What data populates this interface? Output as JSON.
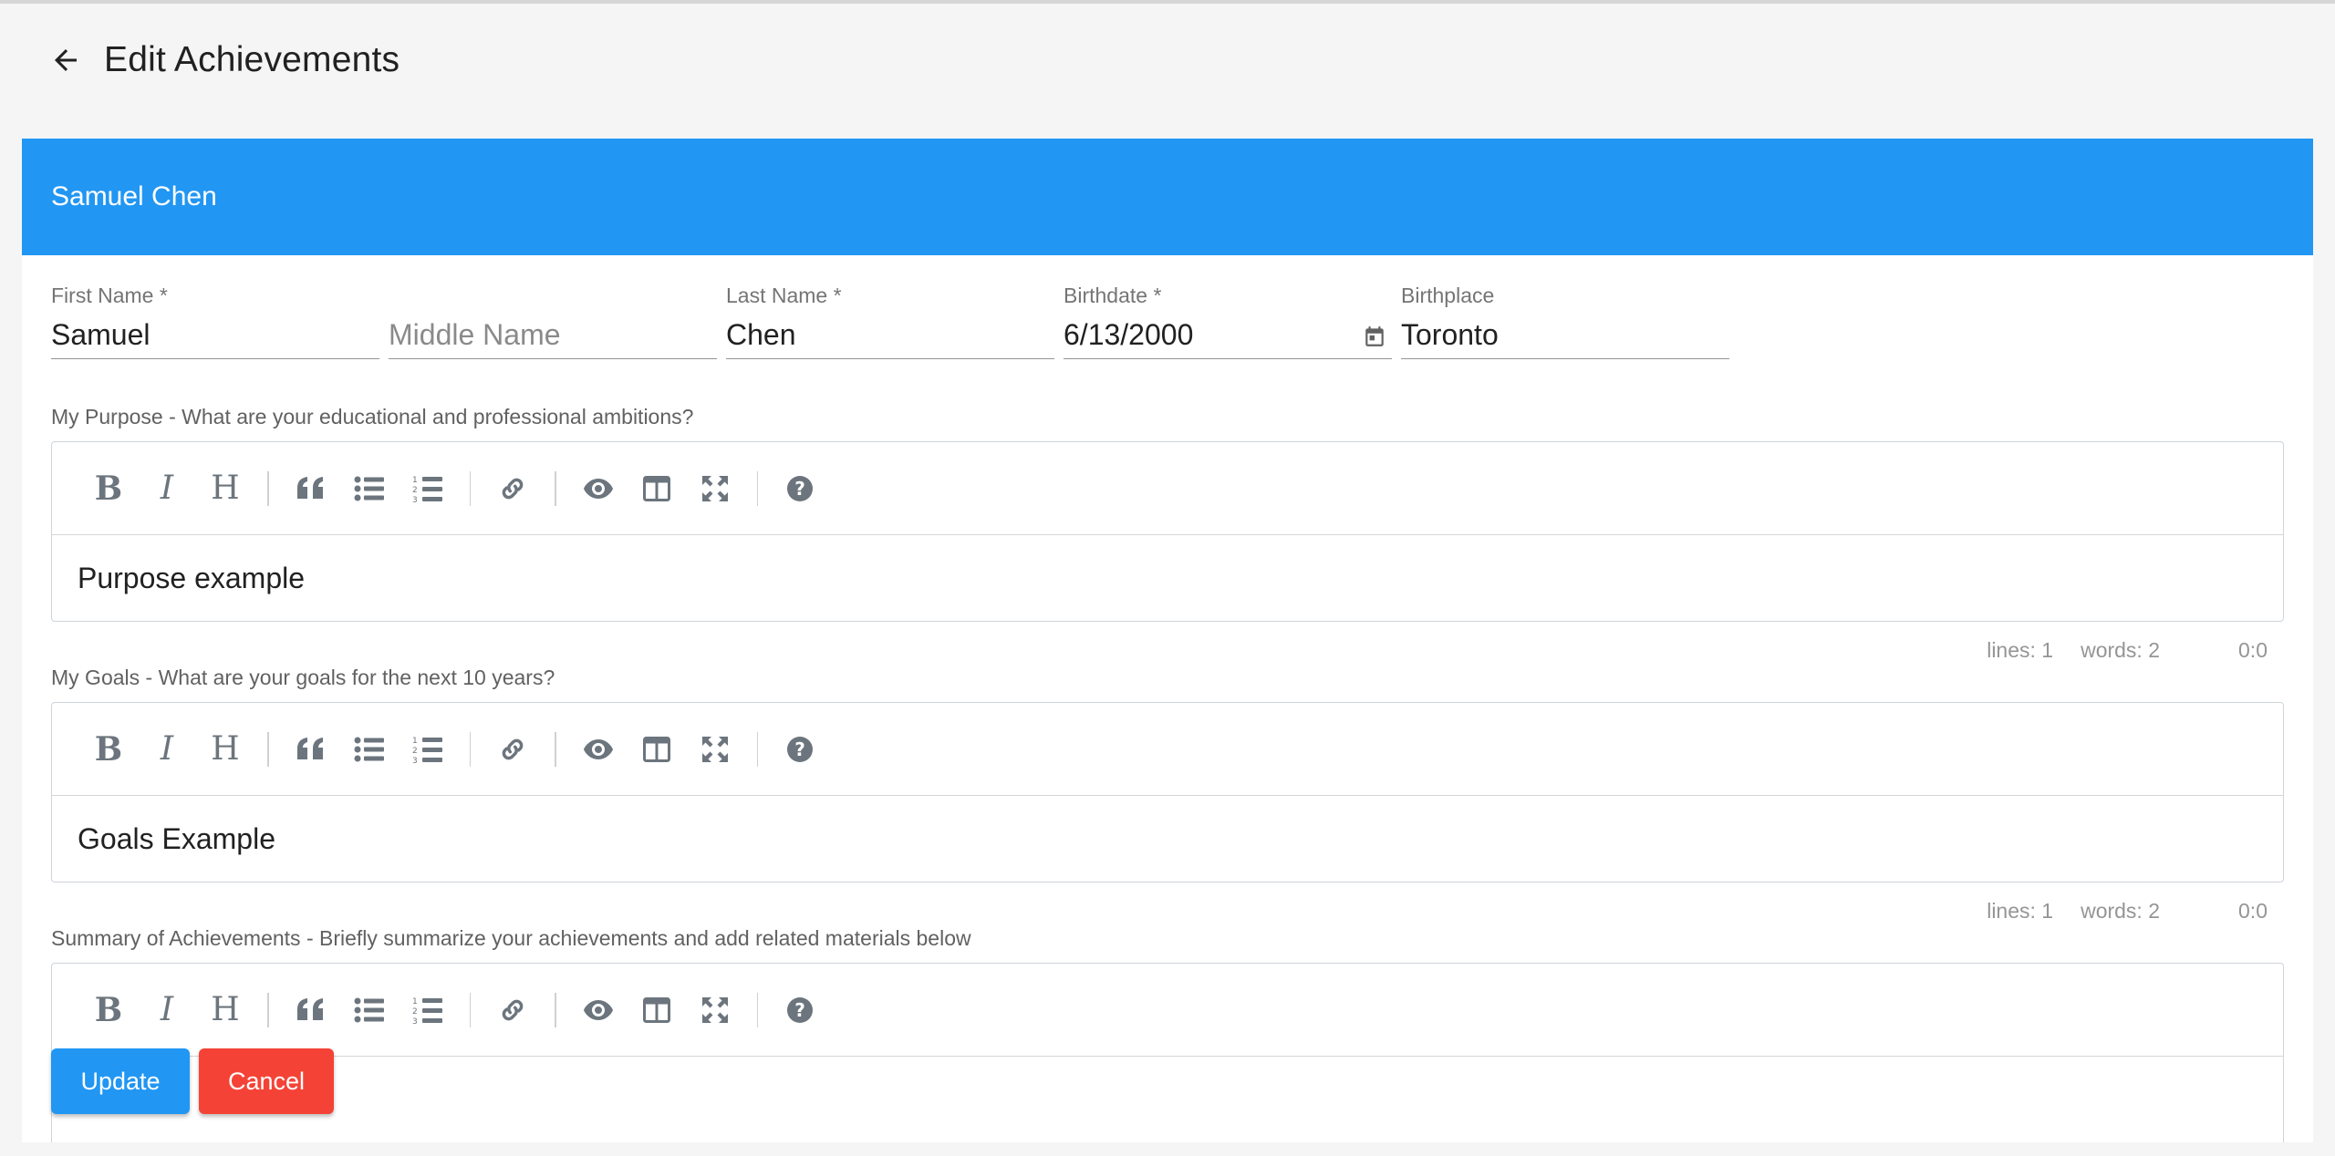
{
  "appbar": {
    "title": "Edit Achievements"
  },
  "student": {
    "name": "Samuel Chen"
  },
  "fields": {
    "first_name": {
      "label": "First Name *",
      "value": "Samuel"
    },
    "middle_name": {
      "placeholder": "Middle Name"
    },
    "last_name": {
      "label": "Last Name *",
      "value": "Chen"
    },
    "birthdate": {
      "label": "Birthdate *",
      "value": "6/13/2000"
    },
    "birthplace": {
      "label": "Birthplace",
      "value": "Toronto"
    }
  },
  "editors": [
    {
      "label": "My Purpose - What are your educational and professional ambitions?",
      "content": "Purpose example",
      "status": {
        "lines": "lines: 1",
        "words": "words: 2",
        "cursor": "0:0"
      }
    },
    {
      "label": "My Goals - What are your goals for the next 10 years?",
      "content": "Goals Example",
      "status": {
        "lines": "lines: 1",
        "words": "words: 2",
        "cursor": "0:0"
      }
    },
    {
      "label": "Summary of Achievements - Briefly summarize your achievements and add related materials below"
    }
  ],
  "toolbar_icons": [
    "bold-icon",
    "italic-icon",
    "heading-icon",
    "quote-icon",
    "unordered-list-icon",
    "ordered-list-icon",
    "link-icon",
    "preview-icon",
    "side-by-side-icon",
    "fullscreen-icon",
    "help-icon"
  ],
  "actions": {
    "update": "Update",
    "cancel": "Cancel"
  },
  "colors": {
    "primary": "#2196f3",
    "danger": "#f44336"
  }
}
